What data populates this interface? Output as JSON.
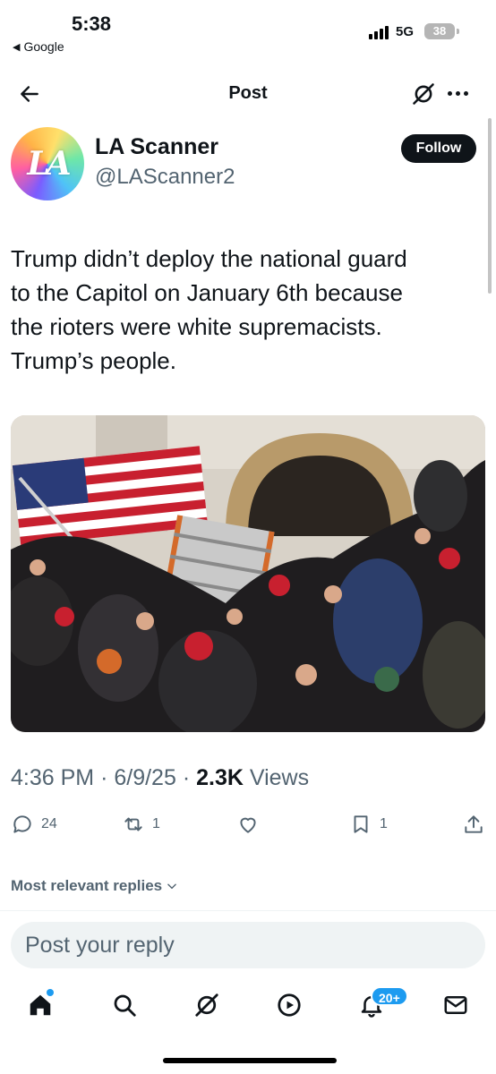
{
  "status_bar": {
    "time": "5:38",
    "back_app": "Google",
    "network": "5G",
    "battery": "38"
  },
  "header": {
    "title": "Post",
    "back_icon": "arrow-left-icon",
    "grok_icon": "grok-icon",
    "more_icon": "more-horizontal-icon"
  },
  "author": {
    "display_name": "LA Scanner",
    "handle": "@LAScanner2",
    "avatar_text": "LA",
    "follow_label": "Follow"
  },
  "tweet": {
    "text_lines": [
      "Trump didn’t deploy the national guard",
      "to the Capitol on January 6th because",
      "the rioters were white supremacists.",
      "Trump’s people."
    ],
    "time": "4:36 PM",
    "date": "6/9/25",
    "views_count": "2.3K",
    "views_label": "Views",
    "separator": "·"
  },
  "actions": {
    "replies": "24",
    "reposts": "1",
    "likes": "",
    "bookmarks": "1"
  },
  "replies_section": {
    "sort_label": "Most relevant replies",
    "reply_placeholder": "Post your reply"
  },
  "tab_bar": {
    "items": [
      "home-icon",
      "search-icon",
      "grok-icon",
      "video-icon",
      "notifications-icon",
      "messages-icon"
    ],
    "notification_badge": "20+"
  },
  "colors": {
    "text_primary": "#0f1419",
    "text_secondary": "#536471",
    "accent": "#1d9bf0",
    "input_bg": "#eff3f4"
  }
}
